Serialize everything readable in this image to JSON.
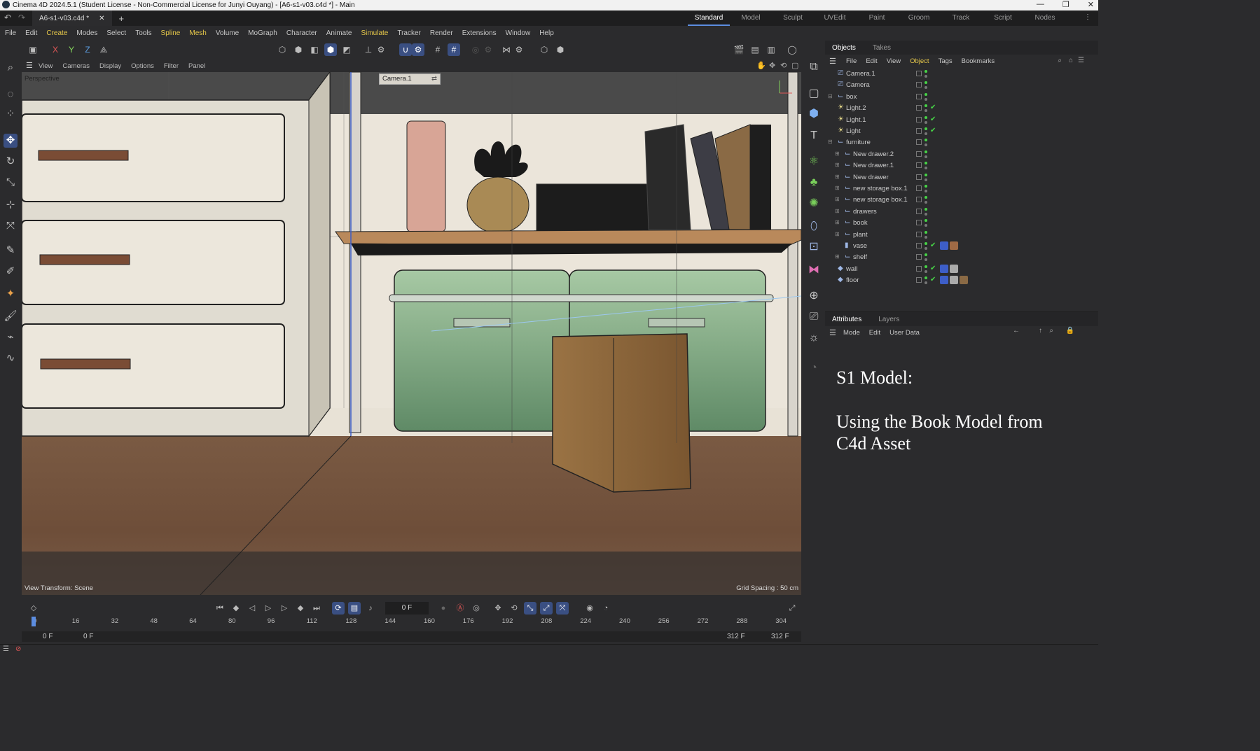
{
  "window": {
    "title": "Cinema 4D 2024.5.1 (Student License - Non-Commercial License for Junyi Ouyang) - [A6-s1-v03.c4d *] - Main",
    "doc_tab": "A6-s1-v03.c4d *"
  },
  "layouts": [
    "Standard",
    "Model",
    "Sculpt",
    "UVEdit",
    "Paint",
    "Groom",
    "Track",
    "Script",
    "Nodes"
  ],
  "active_layout": "Standard",
  "menu": [
    "File",
    "Edit",
    "Create",
    "Modes",
    "Select",
    "Tools",
    "Spline",
    "Mesh",
    "Volume",
    "MoGraph",
    "Character",
    "Animate",
    "Simulate",
    "Tracker",
    "Render",
    "Extensions",
    "Window",
    "Help"
  ],
  "axis_buttons": {
    "x": "X",
    "y": "Y",
    "z": "Z"
  },
  "viewport": {
    "menu": [
      "View",
      "Cameras",
      "Display",
      "Options",
      "Filter",
      "Panel"
    ],
    "label": "Perspective",
    "camera": "Camera.1",
    "view_transform": "View Transform: Scene",
    "grid_spacing": "Grid Spacing : 50 cm"
  },
  "objects_panel": {
    "tabs": [
      "Objects",
      "Takes"
    ],
    "menu": [
      "File",
      "Edit",
      "View",
      "Object",
      "Tags",
      "Bookmarks"
    ],
    "items": [
      {
        "name": "Camera.1",
        "icon": "camera-icon",
        "indent": 0
      },
      {
        "name": "Camera",
        "icon": "camera-icon",
        "indent": 0
      },
      {
        "name": "box",
        "icon": "null-icon",
        "indent": 0
      },
      {
        "name": "Light.2",
        "icon": "light-icon",
        "indent": 0
      },
      {
        "name": "Light.1",
        "icon": "light-icon",
        "indent": 0
      },
      {
        "name": "Light",
        "icon": "light-icon",
        "indent": 0
      },
      {
        "name": "furniture",
        "icon": "null-icon",
        "indent": 0
      },
      {
        "name": "New drawer.2",
        "icon": "null-icon",
        "indent": 1
      },
      {
        "name": "New drawer.1",
        "icon": "null-icon",
        "indent": 1
      },
      {
        "name": "New drawer",
        "icon": "null-icon",
        "indent": 1
      },
      {
        "name": "new storage box.1",
        "icon": "null-icon",
        "indent": 1
      },
      {
        "name": "new storage box.1",
        "icon": "null-icon",
        "indent": 1
      },
      {
        "name": "drawers",
        "icon": "null-icon",
        "indent": 1
      },
      {
        "name": "book",
        "icon": "null-icon",
        "indent": 1
      },
      {
        "name": "plant",
        "icon": "null-icon",
        "indent": 1
      },
      {
        "name": "vase",
        "icon": "cylinder-icon",
        "indent": 1
      },
      {
        "name": "shelf",
        "icon": "null-icon",
        "indent": 1
      },
      {
        "name": "wall",
        "icon": "plane-icon",
        "indent": 0
      },
      {
        "name": "floor",
        "icon": "plane-icon",
        "indent": 0
      }
    ]
  },
  "attributes_panel": {
    "tabs": [
      "Attributes",
      "Layers"
    ],
    "menu": [
      "Mode",
      "Edit",
      "User Data"
    ]
  },
  "note": {
    "line1": "S1 Model:",
    "line2": "Using the Book Model from",
    "line3": "C4d Asset"
  },
  "timeline": {
    "current_frame": "0 F",
    "ticks": [
      "0",
      "16",
      "32",
      "48",
      "64",
      "80",
      "96",
      "112",
      "128",
      "144",
      "160",
      "176",
      "192",
      "208",
      "224",
      "240",
      "256",
      "272",
      "288",
      "304"
    ],
    "start_a": "0 F",
    "start_b": "0 F",
    "end_a": "312 F",
    "end_b": "312 F"
  },
  "colors": {
    "accent": "#3a4f82",
    "highlight_menu": "#e6c84a",
    "status_green": "#47d447"
  }
}
